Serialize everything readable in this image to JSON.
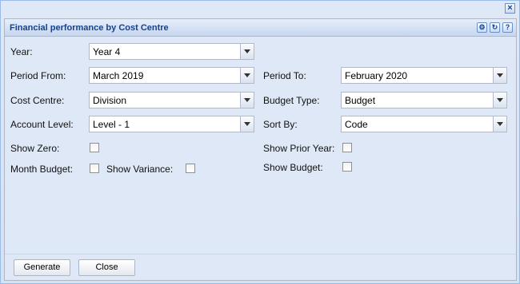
{
  "panel": {
    "title": "Financial performance by Cost Centre"
  },
  "fields": {
    "year": {
      "label": "Year:",
      "value": "Year 4"
    },
    "period_from": {
      "label": "Period From:",
      "value": "March 2019"
    },
    "period_to": {
      "label": "Period To:",
      "value": "February 2020"
    },
    "cost_centre": {
      "label": "Cost Centre:",
      "value": "Division"
    },
    "budget_type": {
      "label": "Budget Type:",
      "value": "Budget"
    },
    "account_level": {
      "label": "Account Level:",
      "value": "Level - 1"
    },
    "sort_by": {
      "label": "Sort By:",
      "value": "Code"
    },
    "show_zero": {
      "label": "Show Zero:",
      "checked": false
    },
    "show_prior_year": {
      "label": "Show Prior Year:",
      "checked": false
    },
    "month_budget": {
      "label": "Month Budget:",
      "checked": false
    },
    "show_variance": {
      "label": "Show Variance:",
      "checked": false
    },
    "show_budget": {
      "label": "Show Budget:",
      "checked": false
    }
  },
  "buttons": {
    "generate": "Generate",
    "close": "Close"
  },
  "icons": {
    "window_close": "close-icon",
    "tools": [
      "gear-icon",
      "refresh-icon",
      "help-icon"
    ]
  }
}
